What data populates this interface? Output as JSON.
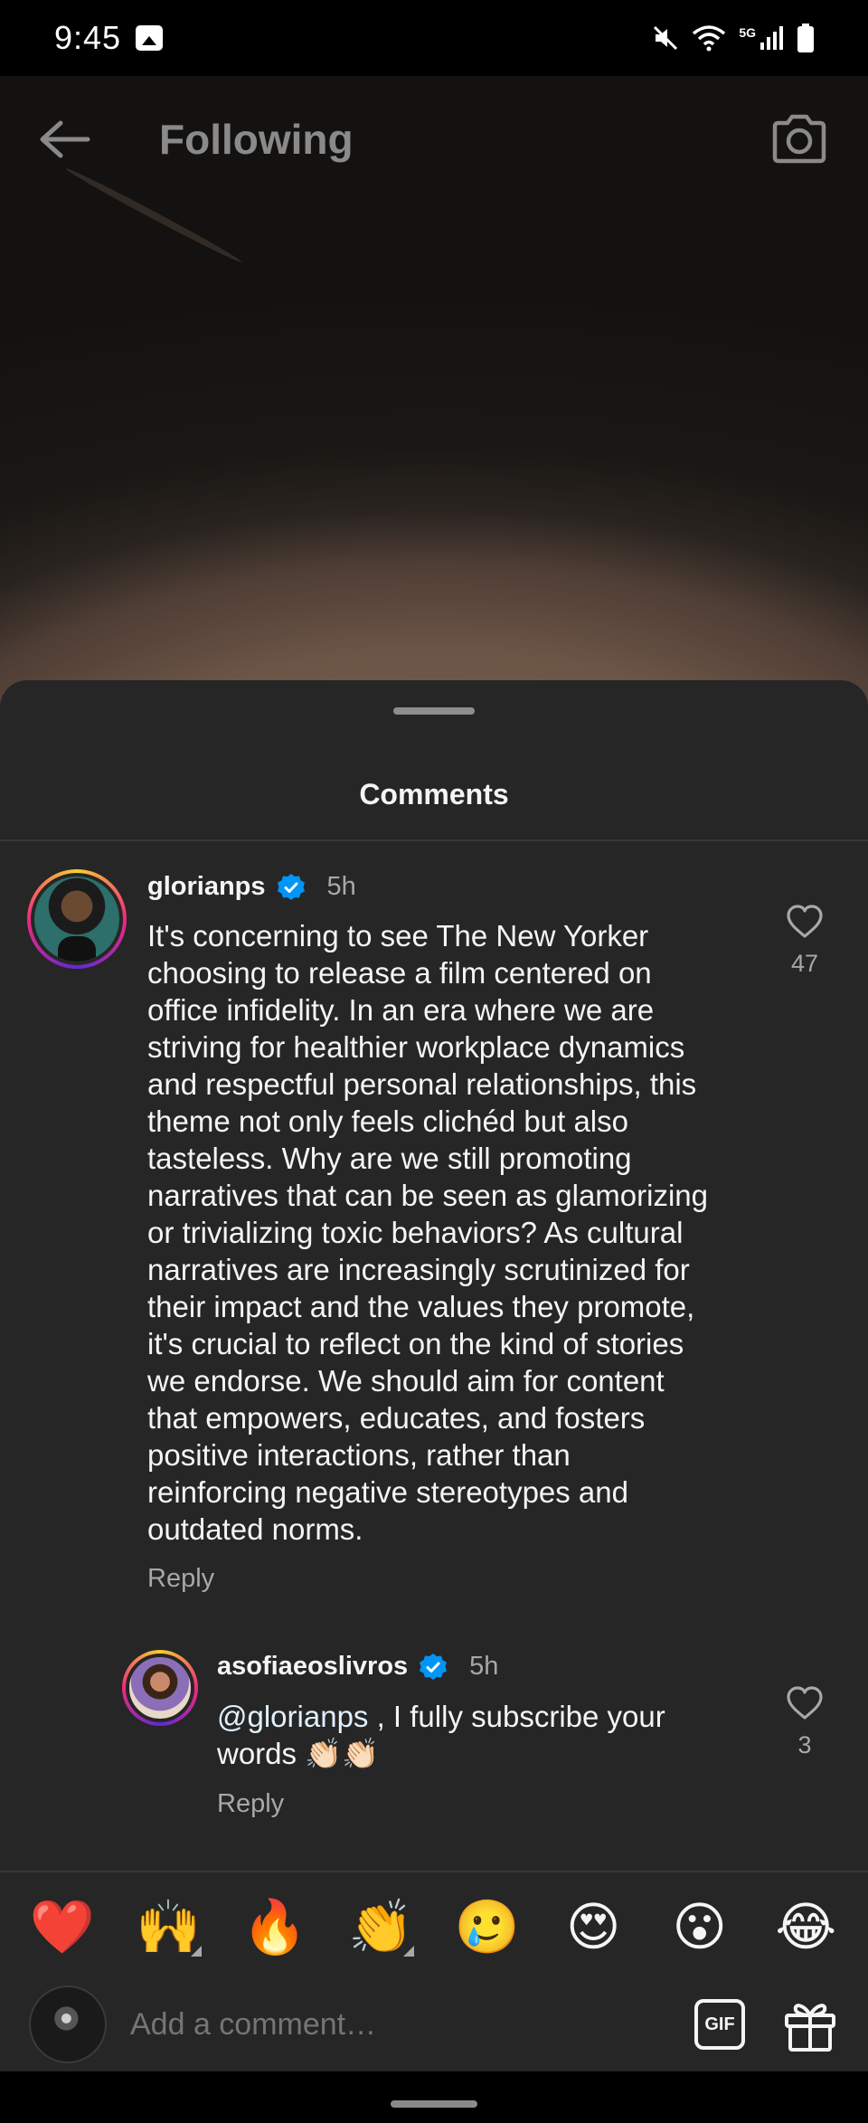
{
  "status_bar": {
    "time": "9:45",
    "network": "5G"
  },
  "header": {
    "title": "Following"
  },
  "sheet": {
    "title": "Comments"
  },
  "comments": [
    {
      "username": "glorianps",
      "time": "5h",
      "text": "It's concerning to see The New Yorker\nchoosing to release a film centered on\noffice infidelity. In an era where we are\nstriving for healthier workplace dynamics\nand respectful personal relationships, this\ntheme not only feels clichéd but also\ntasteless. Why are we still promoting\nnarratives that can be seen as glamorizing\nor trivializing toxic behaviors? As cultural\nnarratives are increasingly scrutinized for\ntheir impact and the values they promote,\nit's crucial to reflect on the kind of stories\nwe endorse. We should aim for content\nthat empowers, educates, and fosters\npositive interactions, rather than\nreinforcing negative stereotypes and\noutdated norms.",
      "reply_label": "Reply",
      "likes": "47"
    },
    {
      "username": "asofiaeoslivros",
      "time": "5h",
      "mention": "@glorianps",
      "text": " , I fully subscribe your\nwords 👏🏻👏🏻",
      "reply_label": "Reply",
      "likes": "3"
    }
  ],
  "emoji_bar": [
    "❤️",
    "🙌",
    "🔥",
    "👏",
    "🥲",
    "😍",
    "😮",
    "😂"
  ],
  "composer": {
    "placeholder": "Add a comment…",
    "gif_label": "GIF"
  },
  "colors": {
    "sheet_bg": "#262626",
    "verified": "#0095f6",
    "secondary_text": "#a8a8a8"
  }
}
